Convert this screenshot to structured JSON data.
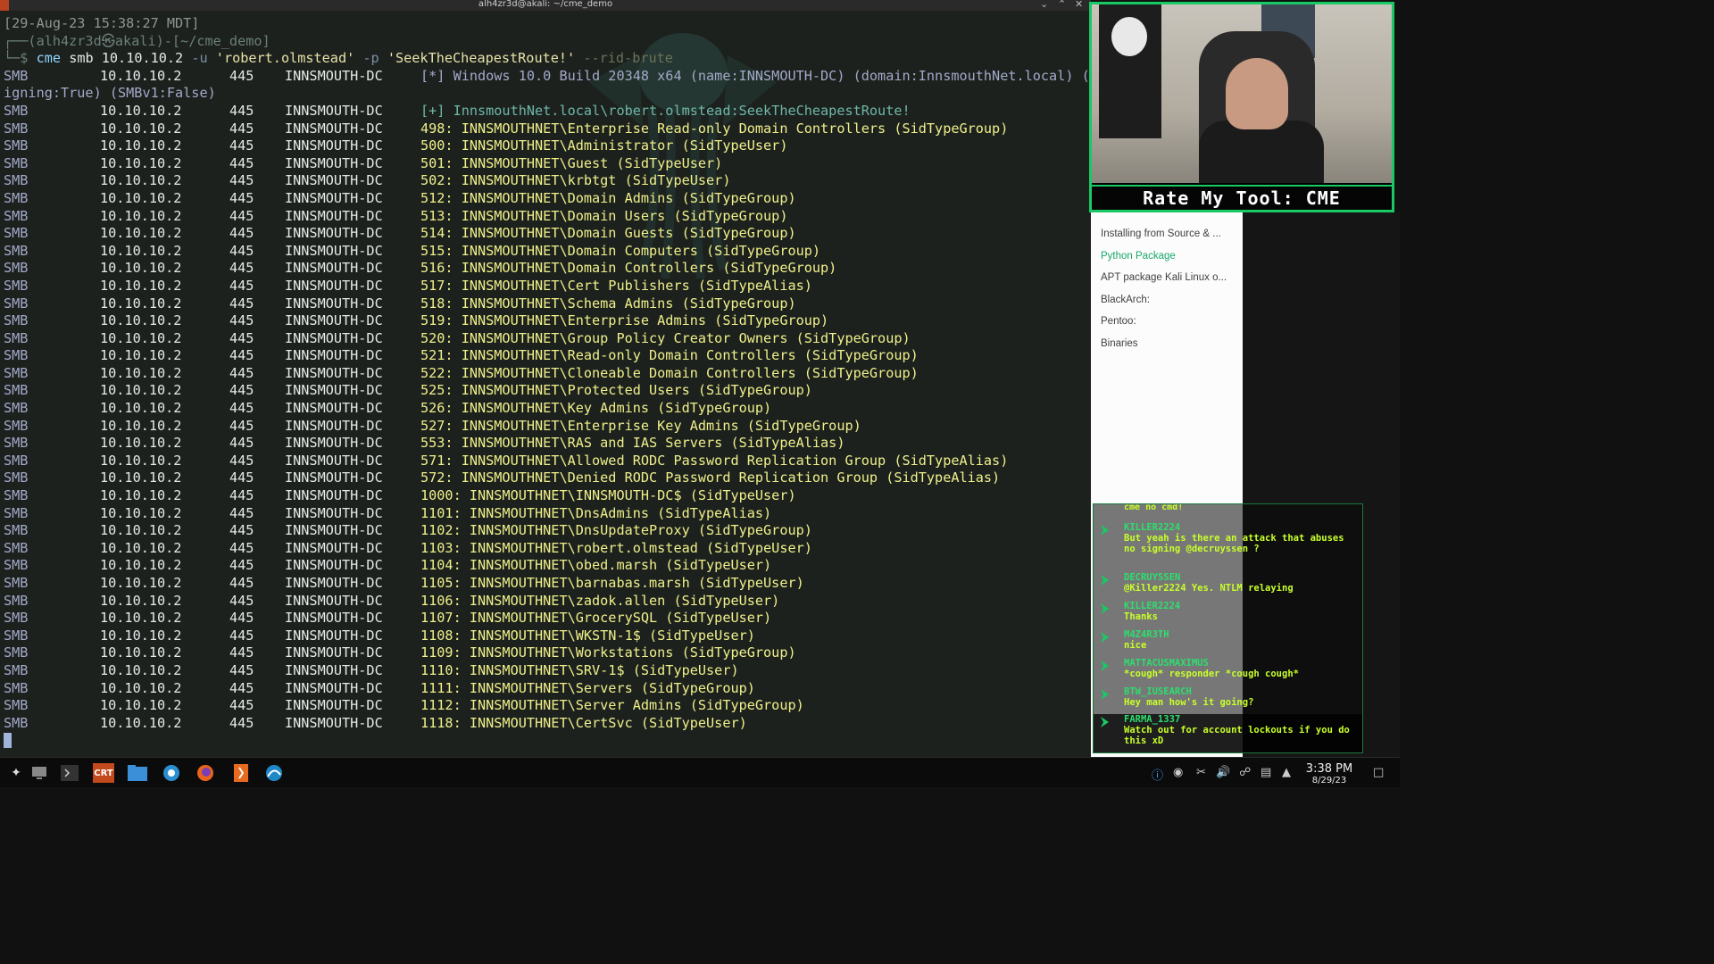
{
  "window": {
    "title": "alh4zr3d@akali: ~/cme_demo"
  },
  "terminal": {
    "timestamp": "[29-Aug-23 15:38:27 MDT]",
    "prompt_user": "┌──(alh4zr3d㉿akali)-[~/cme_demo]",
    "prompt_symbol": "└─$",
    "command": "cme",
    "cmd_args": "smb 10.10.10.2 ",
    "flag_u": "-u",
    "user_arg": "'robert.olmstead'",
    "flag_p": "-p",
    "pass_arg": "'SeekTheCheapestRoute!'",
    "flag_rid": "--rid-brute",
    "windows_info_1": "[*] Windows 10.0 Build 20348 x64 (name:INNSMOUTH-DC) (domain:InnsmouthNet.local) (s",
    "windows_info_2": "igning:True) (SMBv1:False)",
    "success_line": "[+] InnsmouthNet.local\\robert.olmstead:SeekTheCheapestRoute!",
    "proto": "SMB",
    "ip": "10.10.10.2",
    "port": "445",
    "host": "INNSMOUTH-DC",
    "rid_rows": [
      "498: INNSMOUTHNET\\Enterprise Read-only Domain Controllers (SidTypeGroup)",
      "500: INNSMOUTHNET\\Administrator (SidTypeUser)",
      "501: INNSMOUTHNET\\Guest (SidTypeUser)",
      "502: INNSMOUTHNET\\krbtgt (SidTypeUser)",
      "512: INNSMOUTHNET\\Domain Admins (SidTypeGroup)",
      "513: INNSMOUTHNET\\Domain Users (SidTypeGroup)",
      "514: INNSMOUTHNET\\Domain Guests (SidTypeGroup)",
      "515: INNSMOUTHNET\\Domain Computers (SidTypeGroup)",
      "516: INNSMOUTHNET\\Domain Controllers (SidTypeGroup)",
      "517: INNSMOUTHNET\\Cert Publishers (SidTypeAlias)",
      "518: INNSMOUTHNET\\Schema Admins (SidTypeGroup)",
      "519: INNSMOUTHNET\\Enterprise Admins (SidTypeGroup)",
      "520: INNSMOUTHNET\\Group Policy Creator Owners (SidTypeGroup)",
      "521: INNSMOUTHNET\\Read-only Domain Controllers (SidTypeGroup)",
      "522: INNSMOUTHNET\\Cloneable Domain Controllers (SidTypeGroup)",
      "525: INNSMOUTHNET\\Protected Users (SidTypeGroup)",
      "526: INNSMOUTHNET\\Key Admins (SidTypeGroup)",
      "527: INNSMOUTHNET\\Enterprise Key Admins (SidTypeGroup)",
      "553: INNSMOUTHNET\\RAS and IAS Servers (SidTypeAlias)",
      "571: INNSMOUTHNET\\Allowed RODC Password Replication Group (SidTypeAlias)",
      "572: INNSMOUTHNET\\Denied RODC Password Replication Group (SidTypeAlias)",
      "1000: INNSMOUTHNET\\INNSMOUTH-DC$ (SidTypeUser)",
      "1101: INNSMOUTHNET\\DnsAdmins (SidTypeAlias)",
      "1102: INNSMOUTHNET\\DnsUpdateProxy (SidTypeGroup)",
      "1103: INNSMOUTHNET\\robert.olmstead (SidTypeUser)",
      "1104: INNSMOUTHNET\\obed.marsh (SidTypeUser)",
      "1105: INNSMOUTHNET\\barnabas.marsh (SidTypeUser)",
      "1106: INNSMOUTHNET\\zadok.allen (SidTypeUser)",
      "1107: INNSMOUTHNET\\GrocerySQL (SidTypeUser)",
      "1108: INNSMOUTHNET\\WKSTN-1$ (SidTypeUser)",
      "1109: INNSMOUTHNET\\Workstations (SidTypeGroup)",
      "1110: INNSMOUTHNET\\SRV-1$ (SidTypeUser)",
      "1111: INNSMOUTHNET\\Servers (SidTypeGroup)",
      "1112: INNSMOUTHNET\\Server Admins (SidTypeGroup)",
      "1118: INNSMOUTHNET\\CertSvc (SidTypeUser)"
    ]
  },
  "webcam": {
    "banner": "Rate My Tool: CME"
  },
  "docs": {
    "items": [
      "Installing from Source & ...",
      "Python Package",
      "APT package Kali Linux o...",
      "BlackArch:",
      "Pentoo:",
      "Binaries"
    ],
    "active_index": 1
  },
  "chat": {
    "scroll_cut": "cme no cmd!",
    "messages": [
      {
        "user": "KILLER2224",
        "text": "But yeah is there an attack that abuses no signing @decruyssen ?"
      },
      {
        "user": "DECRUYSSEN",
        "text": "@Killer2224 Yes. NTLM relaying"
      },
      {
        "user": "KILLER2224",
        "text": "Thanks"
      },
      {
        "user": "M4Z4R3TH",
        "text": "nice"
      },
      {
        "user": "MATTACUSMAXIMUS",
        "text": "*cough* responder *cough cough*"
      },
      {
        "user": "BTW_IUSEARCH",
        "text": "Hey man how's it going?"
      },
      {
        "user": "FARMA_1337",
        "text": "Watch out for account lockouts if you do this xD"
      }
    ]
  },
  "taskbar": {
    "crt_label": "CRT",
    "time": "3:38 PM",
    "date": "8/29/23"
  },
  "colors": {
    "accent_green": "#18c964",
    "chat_text": "#c8ff2a",
    "rid_yellow": "#f0f08a"
  }
}
